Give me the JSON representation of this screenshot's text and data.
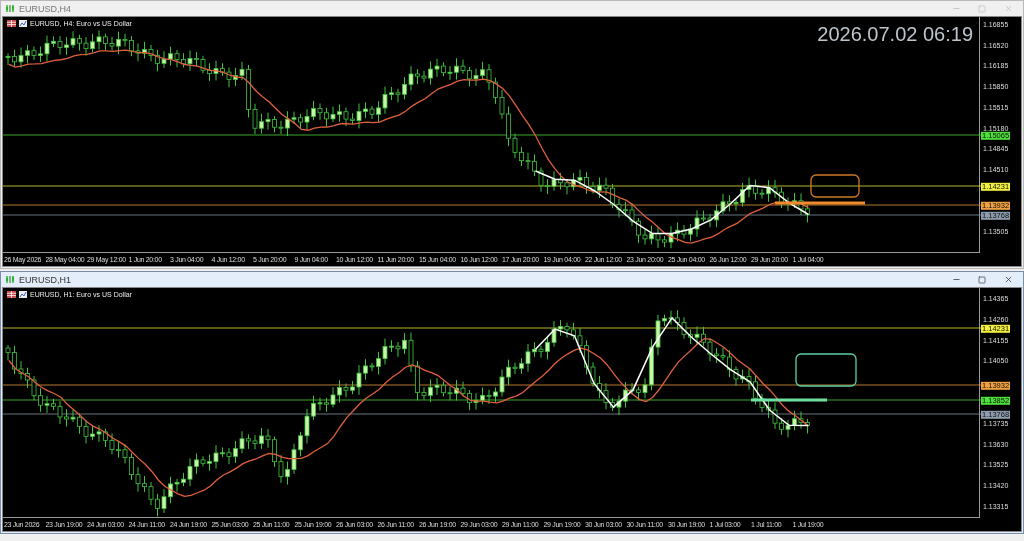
{
  "windows": [
    {
      "title": "EURUSD,H4",
      "active": false,
      "chart": {
        "header": "EURUSD, H4: Euro vs US Dollar",
        "clock": "2026.07.02 06:19",
        "price_ticks": [
          "1.16855",
          "1.16520",
          "1.16185",
          "1.15850",
          "1.15515",
          "1.15180",
          "1.14845",
          "1.14510",
          "1.13505"
        ],
        "levels": [
          {
            "price": "1.15065",
            "color": "#4ee03a"
          },
          {
            "price": "1.14231",
            "color": "#f2f03c"
          },
          {
            "price": "1.13932",
            "color": "#f0a040"
          },
          {
            "price": "1.13768",
            "color": "#8c9cac"
          }
        ],
        "time_ticks": [
          "26 May 2026",
          "28 May 04:00",
          "29 May 12:00",
          "1 Jun 20:00",
          "3 Jun 04:00",
          "4 Jun 12:00",
          "5 Jun 20:00",
          "9 Jun 04:00",
          "10 Jun 12:00",
          "11 Jun 20:00",
          "15 Jun 04:00",
          "16 Jun 12:00",
          "17 Jun 20:00",
          "19 Jun 04:00",
          "22 Jun 12:00",
          "23 Jun 20:00",
          "25 Jun 04:00",
          "26 Jun 12:00",
          "29 Jun 20:00",
          "1 Jul 04:00"
        ]
      }
    },
    {
      "title": "EURUSD,H1",
      "active": true,
      "chart": {
        "header": "EURUSD, H1: Euro vs US Dollar",
        "price_ticks": [
          "1.14365",
          "1.14260",
          "1.14155",
          "1.14050",
          "1.13735",
          "1.13630",
          "1.13525",
          "1.13420",
          "1.13315"
        ],
        "levels": [
          {
            "price": "1.14231",
            "color": "#f2f03c"
          },
          {
            "price": "1.13932",
            "color": "#f0a040"
          },
          {
            "price": "1.13852",
            "color": "#4ee03a"
          },
          {
            "price": "1.13768",
            "color": "#8c9cac"
          }
        ],
        "time_ticks": [
          "23 Jun 2026",
          "23 Jun 19:00",
          "24 Jun 03:00",
          "24 Jun 11:00",
          "24 Jun 19:00",
          "25 Jun 03:00",
          "25 Jun 11:00",
          "25 Jun 19:00",
          "26 Jun 03:00",
          "26 Jun 11:00",
          "26 Jun 19:00",
          "29 Jun 03:00",
          "29 Jun 11:00",
          "29 Jun 19:00",
          "30 Jun 03:00",
          "30 Jun 11:00",
          "30 Jun 19:00",
          "1 Jul 03:00",
          "1 Jul 11:00",
          "1 Jul 19:00"
        ]
      }
    }
  ]
}
